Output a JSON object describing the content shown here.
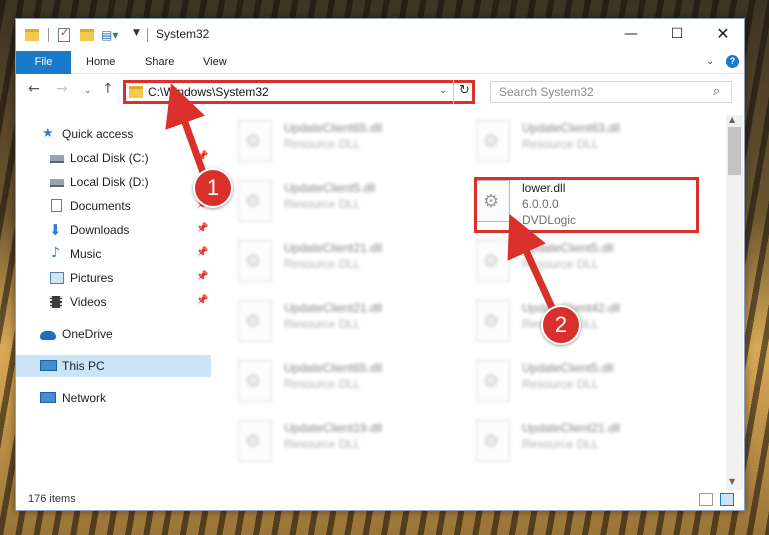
{
  "window": {
    "title": "System32",
    "min_glyph": "—",
    "max_glyph": "☐",
    "close_glyph": "✕"
  },
  "ribbon": {
    "file": "File",
    "home": "Home",
    "share": "Share",
    "view": "View",
    "help": "?"
  },
  "address": {
    "path": "C:\\Windows\\System32"
  },
  "search": {
    "placeholder": "Search System32"
  },
  "nav": {
    "items": [
      {
        "label": "Quick access",
        "icon": "star-icon",
        "pinned": false
      },
      {
        "label": "Local Disk (C:)",
        "icon": "drive-icon",
        "pinned": true
      },
      {
        "label": "Local Disk (D:)",
        "icon": "drive-icon",
        "pinned": true
      },
      {
        "label": "Documents",
        "icon": "documents-icon",
        "pinned": true
      },
      {
        "label": "Downloads",
        "icon": "download-icon",
        "pinned": true
      },
      {
        "label": "Music",
        "icon": "music-icon",
        "pinned": true
      },
      {
        "label": "Pictures",
        "icon": "pictures-icon",
        "pinned": true
      },
      {
        "label": "Videos",
        "icon": "videos-icon",
        "pinned": true
      },
      {
        "label": "OneDrive",
        "icon": "cloud-icon",
        "pinned": false
      },
      {
        "label": "This PC",
        "icon": "computer-icon",
        "pinned": false
      },
      {
        "label": "Network",
        "icon": "network-icon",
        "pinned": false
      }
    ]
  },
  "files": {
    "col1": [
      {
        "name": "UpdateClient65.dll",
        "desc": "Resource DLL"
      },
      {
        "name": "UpdateClient5.dll",
        "desc": "Resource DLL"
      },
      {
        "name": "UpdateClient21.dll",
        "desc": "Resource DLL"
      },
      {
        "name": "UpdateClient21.dll",
        "desc": "Resource DLL"
      },
      {
        "name": "UpdateClient65.dll",
        "desc": "Resource DLL"
      },
      {
        "name": "UpdateClient19.dll",
        "desc": "Resource DLL"
      }
    ],
    "col2": [
      {
        "name": "UpdateClient63.dll",
        "desc": "Resource DLL"
      },
      {
        "name": "UpdateClient5.dll",
        "desc": "Resource DLL"
      },
      {
        "name": "UpdateClient42.dll",
        "desc": "Resource DLL"
      },
      {
        "name": "UpdateClient5.dll",
        "desc": "Resource DLL"
      },
      {
        "name": "UpdateClient21.dll",
        "desc": "Resource DLL"
      }
    ],
    "selected": {
      "name": "lower.dll",
      "version": "6.0.0.0",
      "company": "DVDLogic"
    }
  },
  "status": {
    "count": "176 items"
  },
  "annotations": {
    "step1": "1",
    "step2": "2",
    "color": "#d9302c"
  }
}
